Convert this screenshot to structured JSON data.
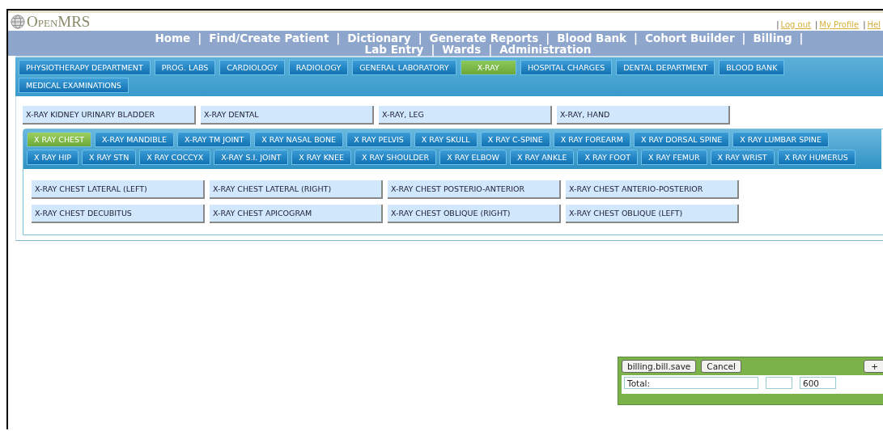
{
  "header": {
    "logo": "OpenMRS",
    "top_links": [
      {
        "sep": "|",
        "label": "Log out"
      },
      {
        "sep": "|",
        "label": "My Profile"
      },
      {
        "sep": "|",
        "label": "Hel"
      }
    ]
  },
  "nav": [
    {
      "kind": "link",
      "label": "Home"
    },
    {
      "kind": "sep",
      "label": "|"
    },
    {
      "kind": "link",
      "label": "Find/Create Patient"
    },
    {
      "kind": "sep",
      "label": "|"
    },
    {
      "kind": "link",
      "label": "Dictionary"
    },
    {
      "kind": "sep",
      "label": "|"
    },
    {
      "kind": "link",
      "label": "Generate Reports"
    },
    {
      "kind": "sep",
      "label": "|"
    },
    {
      "kind": "link",
      "label": "Blood Bank"
    },
    {
      "kind": "sep",
      "label": "|"
    },
    {
      "kind": "link",
      "label": "Cohort Builder"
    },
    {
      "kind": "sep",
      "label": "|"
    },
    {
      "kind": "link",
      "label": "Billing"
    },
    {
      "kind": "sep",
      "label": "|"
    },
    {
      "kind": "link",
      "label": "Lab Entry"
    },
    {
      "kind": "sep",
      "label": "|"
    },
    {
      "kind": "link",
      "label": "Wards"
    },
    {
      "kind": "sep",
      "label": "|"
    },
    {
      "kind": "link",
      "label": "Administration"
    }
  ],
  "department_tabs": [
    {
      "label": "PHYSIOTHERAPY DEPARTMENT",
      "selected": false
    },
    {
      "label": "PROG. LABS",
      "selected": false
    },
    {
      "label": "CARDIOLOGY",
      "selected": false
    },
    {
      "label": "RADIOLOGY",
      "selected": false
    },
    {
      "label": "GENERAL LABORATORY",
      "selected": false
    },
    {
      "label": "X-RAY",
      "selected": true
    },
    {
      "label": "HOSPITAL CHARGES",
      "selected": false
    },
    {
      "label": "DENTAL DEPARTMENT",
      "selected": false
    },
    {
      "label": "BLOOD BANK",
      "selected": false
    },
    {
      "label": "MEDICAL EXAMINATIONS",
      "selected": false
    }
  ],
  "services": [
    "X-RAY KIDNEY URINARY BLADDER",
    "X-RAY DENTAL",
    "X-RAY, LEG",
    "X-RAY, HAND"
  ],
  "body_part_tabs": [
    {
      "label": "X RAY CHEST",
      "selected": true
    },
    {
      "label": "X-RAY MANDIBLE",
      "selected": false
    },
    {
      "label": "X-RAY TM JOINT",
      "selected": false
    },
    {
      "label": "X RAY NASAL BONE",
      "selected": false
    },
    {
      "label": "X RAY PELVIS",
      "selected": false
    },
    {
      "label": "X RAY SKULL",
      "selected": false
    },
    {
      "label": "X RAY C-SPINE",
      "selected": false
    },
    {
      "label": "X RAY FOREARM",
      "selected": false
    },
    {
      "label": "X RAY DORSAL SPINE",
      "selected": false
    },
    {
      "label": "X RAY LUMBAR SPINE",
      "selected": false
    },
    {
      "label": "X RAY HIP",
      "selected": false
    },
    {
      "label": "X RAY STN",
      "selected": false
    },
    {
      "label": "X RAY COCCYX",
      "selected": false
    },
    {
      "label": "X-RAY S.I. JOINT",
      "selected": false
    },
    {
      "label": "X RAY KNEE",
      "selected": false
    },
    {
      "label": "X RAY SHOULDER",
      "selected": false
    },
    {
      "label": "X RAY ELBOW",
      "selected": false
    },
    {
      "label": "X RAY ANKLE",
      "selected": false
    },
    {
      "label": "X RAY FOOT",
      "selected": false
    },
    {
      "label": "X RAY FEMUR",
      "selected": false
    },
    {
      "label": "X RAY WRIST",
      "selected": false
    },
    {
      "label": "X RAY HUMERUS",
      "selected": false
    }
  ],
  "tests": [
    "X-RAY CHEST LATERAL (LEFT)",
    "X-RAY CHEST LATERAL (RIGHT)",
    "X-RAY CHEST POSTERIO-ANTERIOR",
    "X-RAY CHEST ANTERIO-POSTERIOR",
    "X-RAY CHEST DECUBITUS",
    "X-RAY CHEST APICOGRAM",
    "X-RAY CHEST OBLIQUE (RIGHT)",
    "X-RAY CHEST OBLIQUE (LEFT)"
  ],
  "bill": {
    "buttons": [
      "billing.bill.save",
      "Cancel"
    ],
    "add_button": "+",
    "total_label": "Total:",
    "total_value": "600"
  }
}
